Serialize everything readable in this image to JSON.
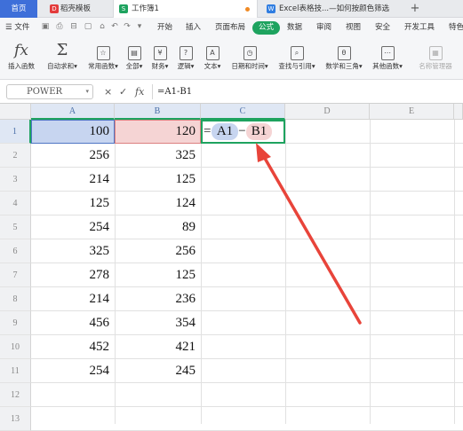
{
  "tabs": {
    "home": "首页",
    "doc": "稻壳模板",
    "workbook": "工作簿1",
    "web": "Excel表格技...—如何按颜色筛选",
    "add": "+"
  },
  "menu": {
    "file": "文件",
    "items": [
      "开始",
      "插入",
      "页面布局",
      "公式",
      "数据",
      "审阅",
      "视图",
      "安全",
      "开发工具",
      "特色"
    ],
    "active": "公式"
  },
  "ribbon": {
    "buttons": [
      {
        "icon": "fx-icon",
        "glyph": "fx",
        "label": "插入函数"
      },
      {
        "icon": "sum-icon",
        "glyph": "Σ",
        "label": "自动求和▾"
      },
      {
        "icon": "star-func-icon",
        "glyph": "☆",
        "label": "常用函数▾"
      },
      {
        "icon": "all-func-icon",
        "glyph": "▤",
        "label": "全部▾"
      },
      {
        "icon": "finance-icon",
        "glyph": "¥",
        "label": "财务▾"
      },
      {
        "icon": "logic-icon",
        "glyph": "?",
        "label": "逻辑▾"
      },
      {
        "icon": "text-icon",
        "glyph": "A",
        "label": "文本▾"
      },
      {
        "icon": "datetime-icon",
        "glyph": "◷",
        "label": "日期和时间▾"
      },
      {
        "icon": "lookup-icon",
        "glyph": "⌕",
        "label": "查找与引用▾"
      },
      {
        "icon": "math-icon",
        "glyph": "θ",
        "label": "数学和三角▾"
      },
      {
        "icon": "other-func-icon",
        "glyph": "⋯",
        "label": "其他函数▾"
      },
      {
        "icon": "name-manager-icon",
        "glyph": "▦",
        "label": "名称管理器"
      }
    ]
  },
  "formula_bar": {
    "name_box": "POWER",
    "cancel_icon": "×",
    "confirm_icon": "✓",
    "fx_label": "fx",
    "formula": "=A1-B1"
  },
  "sheet": {
    "columns": [
      "A",
      "B",
      "C",
      "D",
      "E"
    ],
    "row_numbers": [
      "1",
      "2",
      "3",
      "4",
      "5",
      "6",
      "7",
      "8",
      "9",
      "10",
      "11",
      "12",
      "13"
    ],
    "col_a": [
      "100",
      "256",
      "214",
      "125",
      "254",
      "325",
      "278",
      "214",
      "456",
      "452",
      "254"
    ],
    "col_b": [
      "120",
      "325",
      "125",
      "124",
      "89",
      "256",
      "125",
      "236",
      "354",
      "421",
      "245"
    ],
    "edit_cell": {
      "eq": "=",
      "ref_a": "A1",
      "op": "−",
      "ref_b": "B1"
    }
  },
  "colors": {
    "accent_green": "#1ea35f",
    "ref_a_fill": "#c7d5f0",
    "ref_b_fill": "#f5d4d4",
    "arrow_red": "#e8443a"
  }
}
